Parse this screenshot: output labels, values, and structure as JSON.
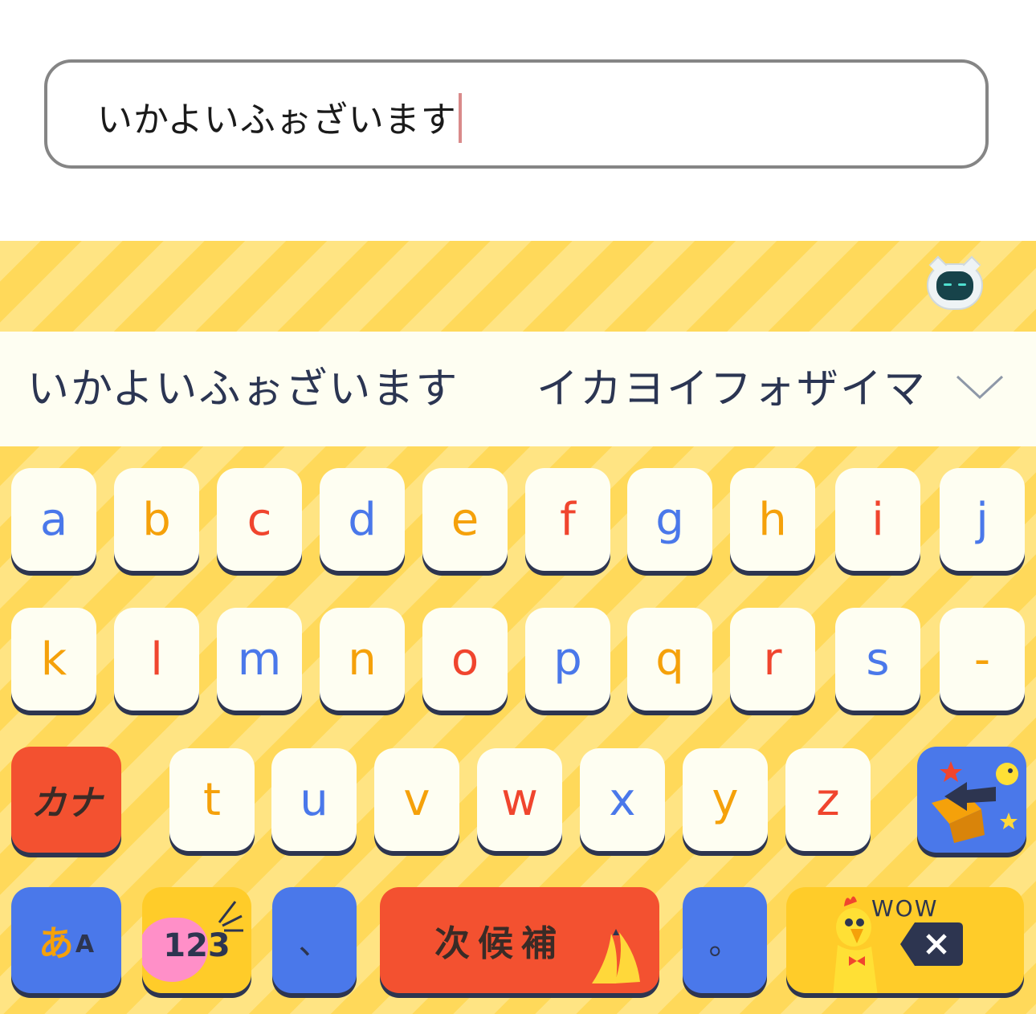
{
  "input": {
    "value": "いかよいふぉざいます"
  },
  "candidates": {
    "items": [
      "いかよいふぉざいます",
      "イカヨイフォザイマス"
    ],
    "expand_icon": "chevron-down-icon"
  },
  "toolbar": {
    "icon": "robot-cat-mascot-icon"
  },
  "keys": {
    "row1": [
      "a",
      "b",
      "c",
      "d",
      "e",
      "f",
      "g",
      "h",
      "i",
      "j"
    ],
    "row2": [
      "k",
      "l",
      "m",
      "n",
      "o",
      "p",
      "q",
      "r",
      "s",
      "-"
    ],
    "row3": [
      "t",
      "u",
      "v",
      "w",
      "x",
      "y",
      "z"
    ]
  },
  "function_keys": {
    "kana": "カナ",
    "lang_main": "あ",
    "lang_sub": "A",
    "numbers": "123",
    "comma": "、",
    "next_candidate": "次候補",
    "period": "。",
    "delete_wow": "WOW"
  },
  "colors": {
    "blue": "#4a78ea",
    "orange": "#f5a10a",
    "red": "#f0452e",
    "key_bg": "#fefef2",
    "stripe_light": "#ffe483",
    "stripe_dark": "#ffd95a"
  }
}
